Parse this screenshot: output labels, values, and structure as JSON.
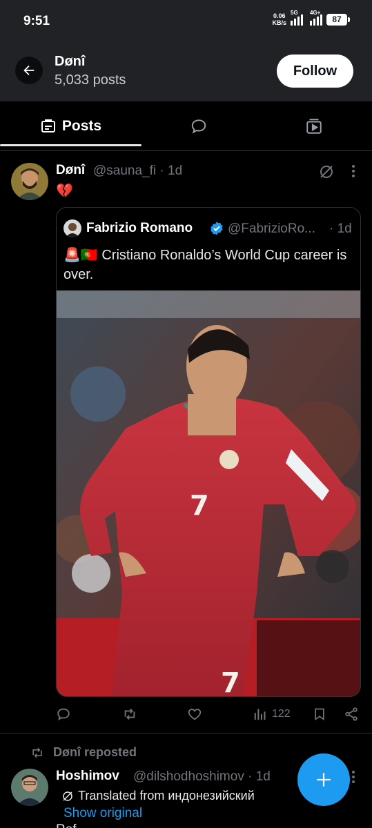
{
  "status_bar": {
    "time": "9:51",
    "speed_value": "0.06",
    "speed_unit": "KB/s",
    "net1": "5G",
    "net2": "4G+",
    "battery": "87"
  },
  "header": {
    "title": "Dønî",
    "post_count": "5,033 posts",
    "follow_label": "Follow"
  },
  "tabs": [
    {
      "label": "Posts",
      "icon": "posts-icon",
      "active": true
    },
    {
      "label": "",
      "icon": "replies-icon",
      "active": false
    },
    {
      "label": "",
      "icon": "media-icon",
      "active": false
    }
  ],
  "post": {
    "author": "Dønî",
    "handle": "@sauna_fi · 1d",
    "text": "💔",
    "quote": {
      "author": "Fabrizio Romano",
      "handle": "@FabrizioRo...",
      "time": "· 1d",
      "text": "🚨🇵🇹 Cristiano Ronaldo’s World Cup career is over."
    },
    "views": "122"
  },
  "repost": {
    "label": "Dønî reposted",
    "author": "Hoshimov",
    "handle": "@dilshodhoshimov · 1d",
    "translated": "Translated from индонезийский",
    "show_original": "Show original",
    "body": "Ref..."
  },
  "colors": {
    "accent": "#1d9bf0",
    "background": "#000000",
    "header_bg": "#202225",
    "muted": "#71767b"
  }
}
